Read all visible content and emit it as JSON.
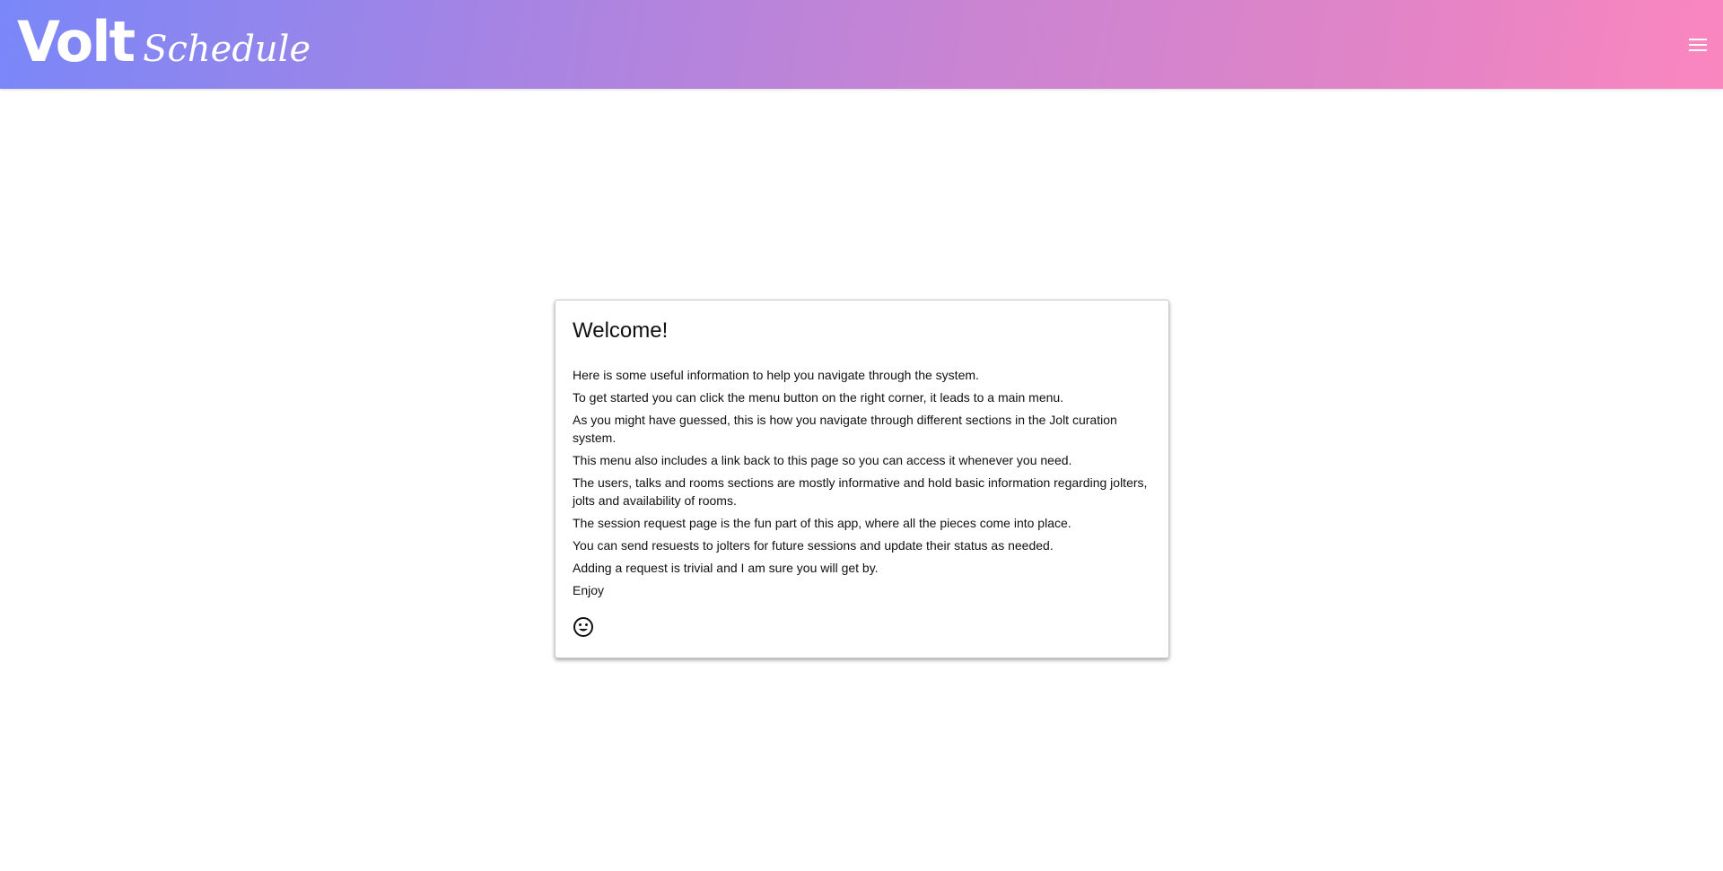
{
  "header": {
    "brand_main": "Volt",
    "brand_sub": "Schedule",
    "menu_icon": "hamburger-menu-icon"
  },
  "welcome": {
    "title": "Welcome!",
    "lines": [
      "Here is some useful information to help you navigate through the system.",
      "To get started you can click the menu button on the right corner, it leads to a main menu.",
      "As you might have guessed, this is how you navigate through different sections in the Jolt curation system.",
      "This menu also includes a link back to this page so you can access it whenever you need.",
      "The users, talks and rooms sections are mostly informative and hold basic information regarding jolters, jolts and availability of rooms.",
      "The session request page is the fun part of this app, where all the pieces come into place.",
      "You can send resuests to jolters for future sessions and update their status as needed.",
      "Adding a request is trivial and I am sure you will get by.",
      "Enjoy"
    ],
    "emoji_icon": "smiley-icon"
  },
  "colors": {
    "gradient_start": "#7a87f8",
    "gradient_end": "#fb86bf",
    "text": "#111111"
  }
}
